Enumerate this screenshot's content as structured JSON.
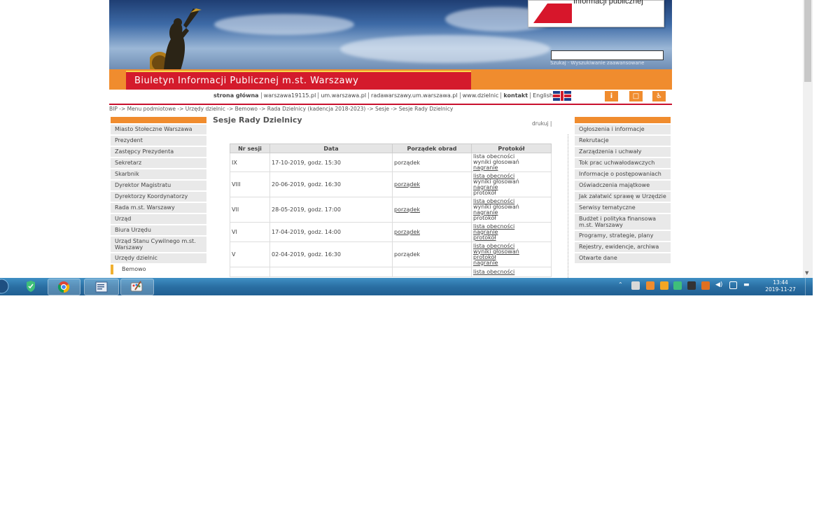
{
  "header": {
    "bip_logo_text": "Informacji publicznej",
    "search_links": "Szukaj · Wyszukiwanie zaawansowane",
    "banner_title": "Biuletyn Informacji Publicznej m.st. Warszawy"
  },
  "topnav": {
    "links": [
      "strona główna",
      "warszawa19115.pl",
      "um.warszawa.pl",
      "radawarszawy.um.warszawa.pl",
      "www.dzielnic",
      "kontakt",
      "English"
    ]
  },
  "breadcrumb": "BIP -> Menu podmiotowe -> Urzędy dzielnic -> Bemowo -> Rada Dzielnicy (kadencja 2018-2023) -> Sesje -> Sesje Rady Dzielnicy",
  "content": {
    "title": "Sesje Rady Dzielnicy",
    "print_link": "drukuj |",
    "columns": [
      "Nr sesji",
      "Data",
      "Porządek obrad",
      "Protokół"
    ],
    "rows": [
      {
        "nr": "IX",
        "date": "17-10-2019, godz. 15:30",
        "order": "porządek",
        "prot": [
          "lista obecności",
          "wyniki głosowań",
          "nagranie"
        ]
      },
      {
        "nr": "VIII",
        "date": "20-06-2019, godz. 16:30",
        "order": "porządek",
        "prot": [
          "lista obecności",
          "wyniki głosowań",
          "nagranie",
          "protokół"
        ]
      },
      {
        "nr": "VII",
        "date": "28-05-2019, godz. 17:00",
        "order": "porządek",
        "prot": [
          "lista obecności",
          "wyniki głosowań",
          "nagranie",
          "protokół"
        ]
      },
      {
        "nr": "VI",
        "date": "17-04-2019, godz. 14:00",
        "order": "porządek",
        "prot": [
          "lista obecności",
          "nagranie",
          "protokół"
        ]
      },
      {
        "nr": "V",
        "date": "02-04-2019, godz. 16:30",
        "order": "porządek",
        "prot": [
          "lista obecności",
          "wyniki głosowań",
          "protokół",
          "nagranie"
        ]
      },
      {
        "nr": "",
        "date": "",
        "order": "",
        "prot": [
          "lista obecności"
        ]
      }
    ]
  },
  "left_menu": [
    "Miasto Stołeczne Warszawa",
    "Prezydent",
    "Zastępcy Prezydenta",
    "Sekretarz",
    "Skarbnik",
    "Dyrektor Magistratu",
    "Dyrektorzy Koordynatorzy",
    "Rada m.st. Warszawy",
    "Urząd",
    "Biura Urzędu",
    "Urząd Stanu Cywilnego m.st. Warszawy",
    "Urzędy dzielnic",
    "Bemowo"
  ],
  "right_menu": [
    "Ogłoszenia i informacje",
    "Rekrutacje",
    "Zarządzenia i uchwały",
    "Tok prac uchwałodawczych",
    "Informacje o postępowaniach",
    "Oświadczenia majątkowe",
    "Jak załatwić sprawę w Urzędzie",
    "Serwisy tematyczne",
    "Budżet i polityka finansowa m.st. Warszawy",
    "Programy, strategie, plany",
    "Rejestry, ewidencje, archiwa",
    "Otwarte dane"
  ],
  "taskbar": {
    "time": "13:44",
    "date": "2019-11-27"
  },
  "colors": {
    "orange": "#f08c2e",
    "red": "#d41b2c",
    "taskbar": "#2a6fa3"
  }
}
